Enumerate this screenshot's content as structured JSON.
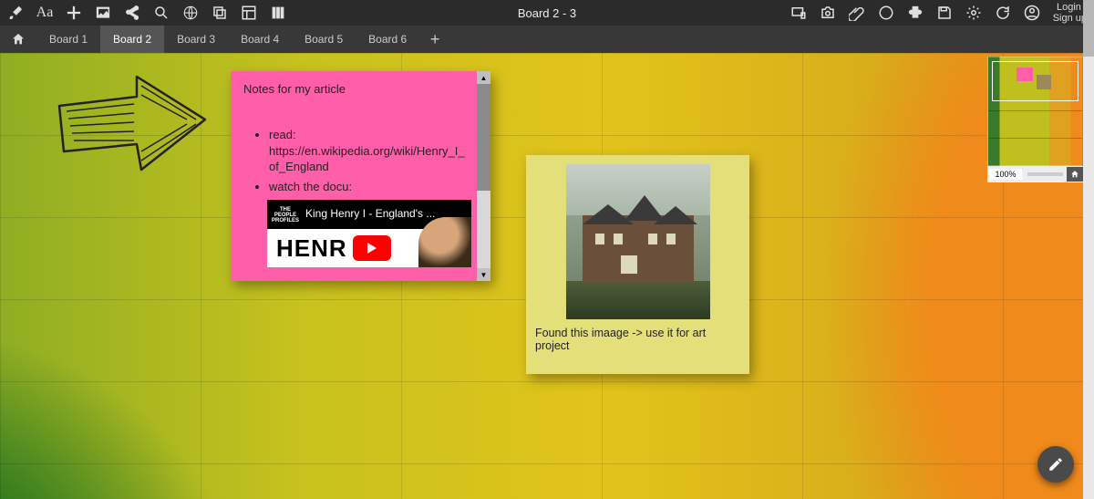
{
  "header": {
    "title": "Board 2 - 3",
    "auth": {
      "login": "Login /",
      "signup": "Sign up"
    }
  },
  "tabs": {
    "items": [
      {
        "label": "Board 1"
      },
      {
        "label": "Board 2"
      },
      {
        "label": "Board 3"
      },
      {
        "label": "Board 4"
      },
      {
        "label": "Board 5"
      },
      {
        "label": "Board 6"
      }
    ],
    "activeIndex": 1
  },
  "notes": {
    "pink": {
      "title": "Notes for my article",
      "bullets": [
        {
          "label": "read:",
          "link": "https://en.wikipedia.org/wiki/Henry_I_of_England"
        },
        {
          "label": "watch the docu:"
        }
      ],
      "video": {
        "title": "King Henry I - England's ...",
        "badge_top": "THE",
        "badge_mid": "PEOPLE",
        "badge_bot": "PROFILES",
        "big": "HENR"
      }
    },
    "yellow": {
      "caption": "Found this imaage -> use it for art project"
    }
  },
  "minimap": {
    "zoom": "100%"
  }
}
